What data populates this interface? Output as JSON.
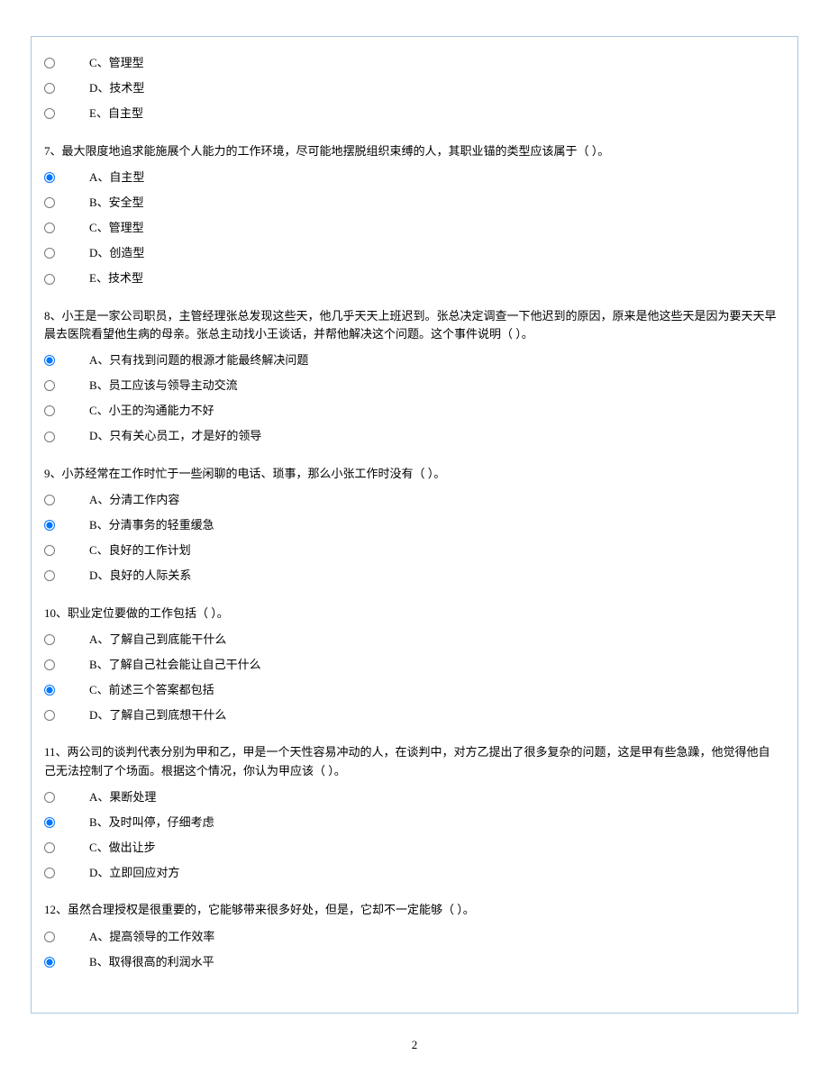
{
  "orphan": {
    "options": [
      {
        "label": "C、管理型",
        "selected": false
      },
      {
        "label": "D、技术型",
        "selected": false
      },
      {
        "label": "E、自主型",
        "selected": false
      }
    ]
  },
  "questions": [
    {
      "stem": "7、最大限度地追求能施展个人能力的工作环境，尽可能地摆脱组织束缚的人，其职业锚的类型应该属于（  ）。",
      "options": [
        {
          "label": "A、自主型",
          "selected": true
        },
        {
          "label": "B、安全型",
          "selected": false
        },
        {
          "label": "C、管理型",
          "selected": false
        },
        {
          "label": "D、创造型",
          "selected": false
        },
        {
          "label": "E、技术型",
          "selected": false
        }
      ]
    },
    {
      "stem": "8、小王是一家公司职员，主管经理张总发现这些天，他几乎天天上班迟到。张总决定调查一下他迟到的原因，原来是他这些天是因为要天天早晨去医院看望他生病的母亲。张总主动找小王谈话，并帮他解决这个问题。这个事件说明（  ）。",
      "options": [
        {
          "label": "A、只有找到问题的根源才能最终解决问题",
          "selected": true
        },
        {
          "label": "B、员工应该与领导主动交流",
          "selected": false
        },
        {
          "label": "C、小王的沟通能力不好",
          "selected": false
        },
        {
          "label": "D、只有关心员工，才是好的领导",
          "selected": false
        }
      ]
    },
    {
      "stem": "9、小苏经常在工作时忙于一些闲聊的电话、琐事，那么小张工作时没有（  ）。",
      "options": [
        {
          "label": "A、分清工作内容",
          "selected": false
        },
        {
          "label": "B、分清事务的轻重缓急",
          "selected": true
        },
        {
          "label": "C、良好的工作计划",
          "selected": false
        },
        {
          "label": "D、良好的人际关系",
          "selected": false
        }
      ]
    },
    {
      "stem": "10、职业定位要做的工作包括（  ）。",
      "options": [
        {
          "label": "A、了解自己到底能干什么",
          "selected": false
        },
        {
          "label": "B、了解自己社会能让自己干什么",
          "selected": false
        },
        {
          "label": "C、前述三个答案都包括",
          "selected": true
        },
        {
          "label": "D、了解自己到底想干什么",
          "selected": false
        }
      ]
    },
    {
      "stem": "11、两公司的谈判代表分别为甲和乙，甲是一个天性容易冲动的人，在谈判中，对方乙提出了很多复杂的问题，这是甲有些急躁，他觉得他自己无法控制了个场面。根据这个情况，你认为甲应该（  ）。",
      "options": [
        {
          "label": "A、果断处理",
          "selected": false
        },
        {
          "label": "B、及时叫停，仔细考虑",
          "selected": true
        },
        {
          "label": "C、做出让步",
          "selected": false
        },
        {
          "label": "D、立即回应对方",
          "selected": false
        }
      ]
    },
    {
      "stem": "12、虽然合理授权是很重要的，它能够带来很多好处，但是，它却不一定能够（  ）。",
      "options": [
        {
          "label": "A、提高领导的工作效率",
          "selected": false
        },
        {
          "label": "B、取得很高的利润水平",
          "selected": true
        }
      ]
    }
  ],
  "page_number": "2"
}
